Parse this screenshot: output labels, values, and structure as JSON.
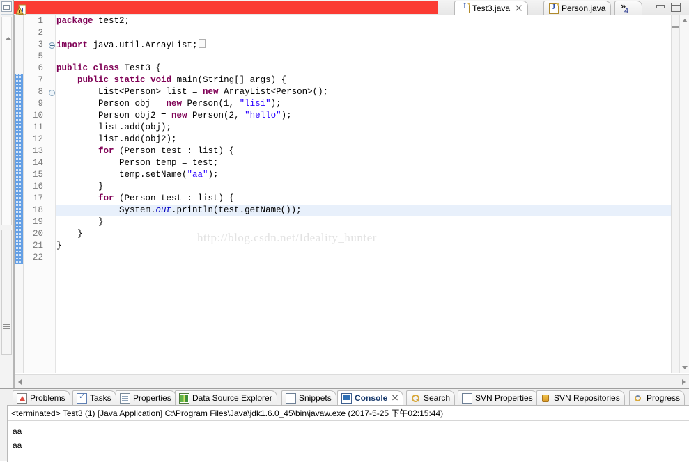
{
  "window": {
    "minimize_label": "Minimize",
    "maximize_label": "Maximize"
  },
  "editor_tabs": {
    "redacted_tab": {
      "icon": "java-file-warning-icon",
      "label": ""
    },
    "tabs": [
      {
        "label": "Test3.java",
        "icon": "java-file-icon",
        "active": true,
        "closable": true
      },
      {
        "label": "Person.java",
        "icon": "java-file-icon",
        "active": false,
        "closable": false
      }
    ],
    "overflow": {
      "chevron": "»",
      "count": "4"
    }
  },
  "editor": {
    "watermark": "http://blog.csdn.net/Ideality_hunter",
    "highlighted_line": 18,
    "lines": [
      {
        "num": "1",
        "fold": "",
        "text": "package test2;"
      },
      {
        "num": "2",
        "fold": "",
        "text": ""
      },
      {
        "num": "3",
        "fold": "plus",
        "text": "import java.util.ArrayList;"
      },
      {
        "num": "5",
        "fold": "",
        "text": ""
      },
      {
        "num": "6",
        "fold": "",
        "text": "public class Test3 {"
      },
      {
        "num": "7",
        "fold": "minus",
        "text": "    public static void main(String[] args) {"
      },
      {
        "num": "8",
        "fold": "",
        "text": "        List<Person> list = new ArrayList<Person>();"
      },
      {
        "num": "9",
        "fold": "",
        "text": "        Person obj = new Person(1, \"lisi\");"
      },
      {
        "num": "10",
        "fold": "",
        "text": "        Person obj2 = new Person(2, \"hello\");"
      },
      {
        "num": "11",
        "fold": "",
        "text": "        list.add(obj);"
      },
      {
        "num": "12",
        "fold": "",
        "text": "        list.add(obj2);"
      },
      {
        "num": "13",
        "fold": "",
        "text": "        for (Person test : list) {"
      },
      {
        "num": "14",
        "fold": "",
        "text": "            Person temp = test;"
      },
      {
        "num": "15",
        "fold": "",
        "text": "            temp.setName(\"aa\");"
      },
      {
        "num": "16",
        "fold": "",
        "text": "        }"
      },
      {
        "num": "17",
        "fold": "",
        "text": "        for (Person test : list) {"
      },
      {
        "num": "18",
        "fold": "",
        "text": "            System.out.println(test.getName());"
      },
      {
        "num": "19",
        "fold": "",
        "text": "        }"
      },
      {
        "num": "20",
        "fold": "",
        "text": "    }"
      },
      {
        "num": "21",
        "fold": "",
        "text": "}"
      },
      {
        "num": "22",
        "fold": "",
        "text": ""
      }
    ]
  },
  "bottom_tabs": [
    {
      "label": "Problems",
      "icon": "problems-icon",
      "active": false
    },
    {
      "label": "Tasks",
      "icon": "tasks-icon",
      "active": false
    },
    {
      "label": "Properties",
      "icon": "properties-icon",
      "active": false
    },
    {
      "label": "Data Source Explorer",
      "icon": "data-source-icon",
      "active": false
    },
    {
      "label": "Snippets",
      "icon": "snippets-icon",
      "active": false
    },
    {
      "label": "Console",
      "icon": "console-icon",
      "active": true
    },
    {
      "label": "Search",
      "icon": "search-icon",
      "active": false
    },
    {
      "label": "SVN Properties",
      "icon": "svn-properties-icon",
      "active": false
    },
    {
      "label": "SVN Repositories",
      "icon": "svn-repositories-icon",
      "active": false
    },
    {
      "label": "Progress",
      "icon": "progress-icon",
      "active": false
    }
  ],
  "console": {
    "header": "<terminated> Test3 (1) [Java Application] C:\\Program Files\\Java\\jdk1.6.0_45\\bin\\javaw.exe (2017-5-25 下午02:15:44)",
    "output": [
      "aa",
      "aa"
    ]
  },
  "colors": {
    "redaction": "#fb3b33",
    "keyword": "#7f0055",
    "string": "#2a00ff",
    "static_field": "#0000c0",
    "line_highlight": "#e8f0fb",
    "change_bar": "#4a90e2",
    "active_view_text": "#17396b"
  }
}
